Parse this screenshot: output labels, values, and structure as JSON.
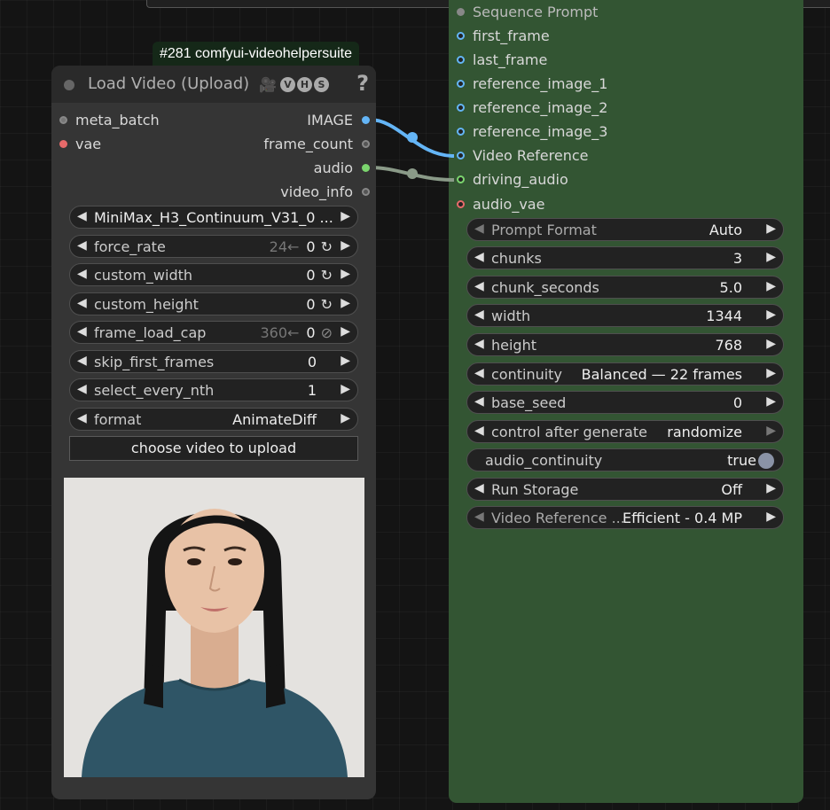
{
  "green_node": {
    "inputs": [
      {
        "label": "Sequence Prompt",
        "color": "gray"
      },
      {
        "label": "first_frame",
        "color": "blue"
      },
      {
        "label": "last_frame",
        "color": "blue"
      },
      {
        "label": "reference_image_1",
        "color": "blue"
      },
      {
        "label": "reference_image_2",
        "color": "blue"
      },
      {
        "label": "reference_image_3",
        "color": "blue"
      },
      {
        "label": "Video Reference",
        "color": "blue"
      },
      {
        "label": "driving_audio",
        "color": "green"
      },
      {
        "label": "audio_vae",
        "color": "red"
      }
    ],
    "widgets": [
      {
        "name": "Prompt Format",
        "value": "Auto"
      },
      {
        "name": "chunks",
        "value": "3"
      },
      {
        "name": "chunk_seconds",
        "value": "5.0"
      },
      {
        "name": "width",
        "value": "1344"
      },
      {
        "name": "height",
        "value": "768"
      },
      {
        "name": "continuity",
        "value": "Balanced — 22 frames"
      },
      {
        "name": "base_seed",
        "value": "0"
      },
      {
        "name": "control after generate",
        "value": "randomize"
      },
      {
        "name": "audio_continuity",
        "value": "true"
      },
      {
        "name": "Run Storage",
        "value": "Off"
      },
      {
        "name": "Video Reference ...",
        "value": "Efficient - 0.4 MP"
      }
    ]
  },
  "load_node": {
    "badge": "#281 comfyui-videohelpersuite",
    "title": "Load Video (Upload)",
    "camera_icon": "film-camera-icon",
    "badges": [
      "V",
      "H",
      "S"
    ],
    "help": "?",
    "inputs": [
      {
        "label": "meta_batch",
        "color": "gray"
      },
      {
        "label": "vae",
        "color": "red"
      }
    ],
    "outputs": [
      {
        "label": "IMAGE",
        "color": "blue"
      },
      {
        "label": "frame_count",
        "color": "gray"
      },
      {
        "label": "audio",
        "color": "green"
      },
      {
        "label": "video_info",
        "color": "gray"
      }
    ],
    "widgets": {
      "video": "MiniMax_H3_Continuum_V31_0 ...",
      "force_rate": {
        "name": "force_rate",
        "ghost": "24←",
        "value": "0"
      },
      "custom_width": {
        "name": "custom_width",
        "value": "0"
      },
      "custom_height": {
        "name": "custom_height",
        "value": "0"
      },
      "frame_load_cap": {
        "name": "frame_load_cap",
        "ghost": "360←",
        "value": "0"
      },
      "skip_first_frames": {
        "name": "skip_first_frames",
        "value": "0"
      },
      "select_every_nth": {
        "name": "select_every_nth",
        "value": "1"
      },
      "format": {
        "name": "format",
        "value": "AnimateDiff"
      }
    },
    "upload_label": "choose video to upload",
    "preview_icon": "video-preview-portrait"
  },
  "colors": {
    "green_node": "#335533",
    "gray_node": "#353535",
    "link_image": "#64b5f6",
    "link_audio": "#8a9a88"
  }
}
